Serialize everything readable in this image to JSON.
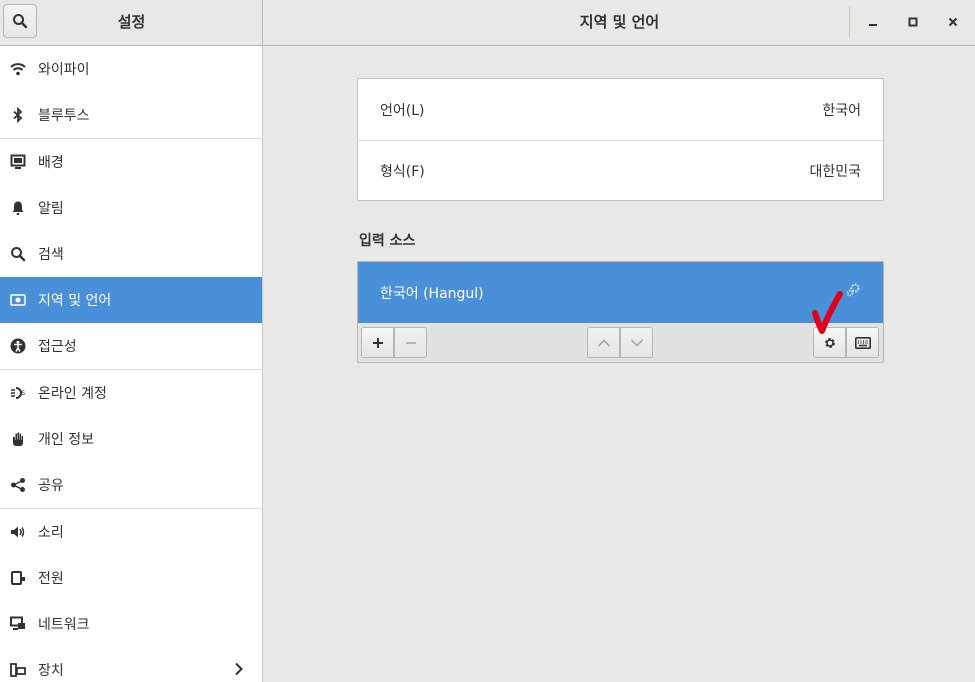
{
  "header": {
    "sidebar_title": "설정",
    "title": "지역 및 언어"
  },
  "sidebar": {
    "items": [
      {
        "label": "와이파이",
        "icon": "wifi-icon"
      },
      {
        "label": "블루투스",
        "icon": "bluetooth-icon"
      },
      {
        "label": "배경",
        "icon": "background-icon"
      },
      {
        "label": "알림",
        "icon": "bell-icon"
      },
      {
        "label": "검색",
        "icon": "search-icon"
      },
      {
        "label": "지역 및 언어",
        "icon": "region-icon",
        "active": true
      },
      {
        "label": "접근성",
        "icon": "accessibility-icon"
      },
      {
        "label": "온라인 계정",
        "icon": "online-accounts-icon"
      },
      {
        "label": "개인 정보",
        "icon": "privacy-hand-icon"
      },
      {
        "label": "공유",
        "icon": "share-icon"
      },
      {
        "label": "소리",
        "icon": "speaker-icon"
      },
      {
        "label": "전원",
        "icon": "power-icon"
      },
      {
        "label": "네트워크",
        "icon": "network-icon"
      },
      {
        "label": "장치",
        "icon": "devices-icon"
      }
    ]
  },
  "language_card": {
    "language_label": "언어(L)",
    "language_value": "한국어",
    "formats_label": "형식(F)",
    "formats_value": "대한민국"
  },
  "input_sources": {
    "title": "입력 소스",
    "items": [
      {
        "label": "한국어 (Hangul)",
        "selected": true
      }
    ]
  },
  "colors": {
    "accent": "#4a90d9",
    "sidebar_bg": "#ffffff",
    "panel_bg": "#e8e8e7",
    "annotation": "#e0001b"
  }
}
